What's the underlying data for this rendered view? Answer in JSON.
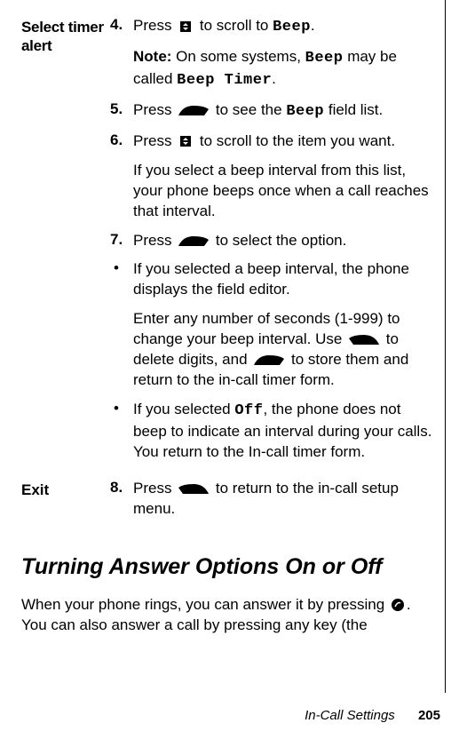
{
  "left_labels": {
    "select_timer_alert": "Select timer alert",
    "exit": "Exit"
  },
  "steps": {
    "s4": {
      "num": "4.",
      "pre": "Press ",
      "post_a": " to scroll to ",
      "beep": "Beep",
      "end": "."
    },
    "s4_note": {
      "label": "Note: ",
      "text_a": "On some systems, ",
      "beep": "Beep",
      "text_b": " may be called ",
      "beep_timer": "Beep Timer",
      "end": "."
    },
    "s5": {
      "num": "5.",
      "pre": "Press ",
      "post_a": " to see the ",
      "beep": "Beep",
      "post_b": " field list."
    },
    "s6": {
      "num": "6.",
      "pre": "Press ",
      "post": " to scroll to the item you want."
    },
    "s6_sub": "If you select a beep interval from this list, your phone beeps once when a call reaches that interval.",
    "s7": {
      "num": "7.",
      "pre": "Press ",
      "post": " to select the option."
    },
    "b1": {
      "text": "If you selected a beep interval, the phone displays the field editor."
    },
    "b1_sub": {
      "a": "Enter any number of seconds (1-999) to change your beep interval. Use ",
      "b": " to delete digits, and ",
      "c": " to store them and return to the in-call timer form."
    },
    "b2": {
      "a": "If you selected ",
      "off": "Off",
      "b": ", the phone does not beep to indicate an interval during your calls. You return to the In-call timer form."
    },
    "s8": {
      "num": "8.",
      "pre": "Press ",
      "post": " to return to the in-call setup menu."
    }
  },
  "section_title": "Turning Answer Options On or Off",
  "body_para": {
    "a": "When your phone rings, you can answer it by pressing ",
    "b": ". You can also answer a call by pressing any key (the"
  },
  "footer": {
    "section": "In-Call Settings",
    "page": "205"
  }
}
